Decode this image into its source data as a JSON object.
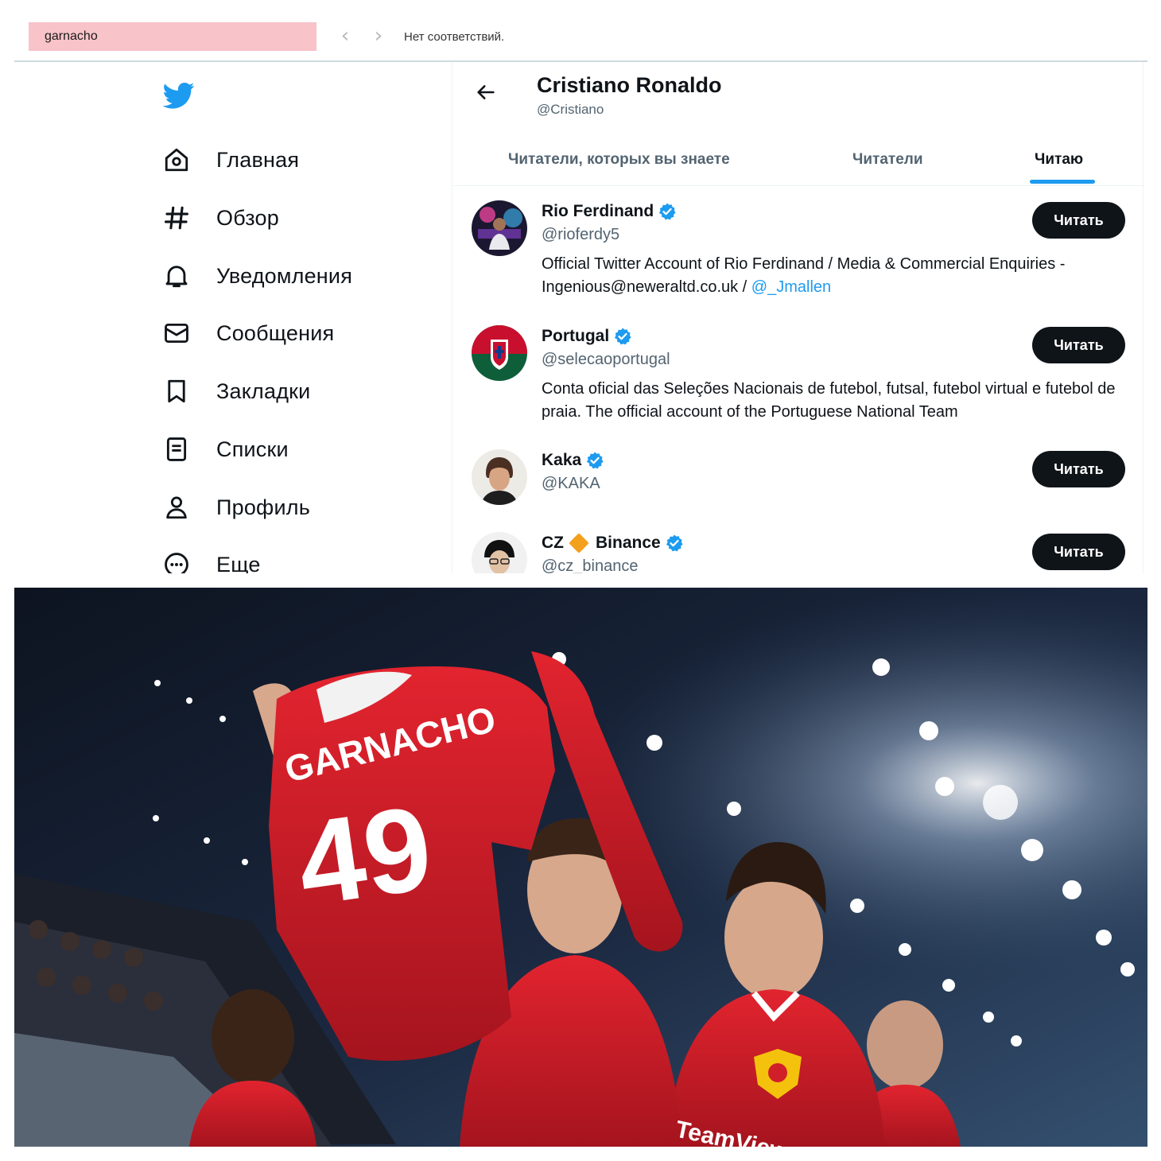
{
  "findbar": {
    "query": "garnacho",
    "status": "Нет соответствий."
  },
  "sidebar": {
    "items": [
      {
        "label": "Главная",
        "icon": "home-icon"
      },
      {
        "label": "Обзор",
        "icon": "hashtag-icon"
      },
      {
        "label": "Уведомления",
        "icon": "bell-icon"
      },
      {
        "label": "Сообщения",
        "icon": "envelope-icon"
      },
      {
        "label": "Закладки",
        "icon": "bookmark-icon"
      },
      {
        "label": "Списки",
        "icon": "list-icon"
      },
      {
        "label": "Профиль",
        "icon": "person-icon"
      },
      {
        "label": "Еще",
        "icon": "more-circle-icon"
      }
    ]
  },
  "header": {
    "name": "Cristiano Ronaldo",
    "handle": "@Cristiano"
  },
  "tabs": [
    {
      "label": "Читатели, которых вы знаете",
      "active": false
    },
    {
      "label": "Читатели",
      "active": false
    },
    {
      "label": "Читаю",
      "active": true
    }
  ],
  "users": [
    {
      "name": "Rio Ferdinand",
      "handle": "@rioferdy5",
      "bio": "Official Twitter Account of Rio Ferdinand / Media & Commercial Enquiries - Ingenious@neweraltd.co.uk / ",
      "bio_mention": "@_Jmallen",
      "follow_label": "Читать"
    },
    {
      "name": "Portugal",
      "handle": "@selecaoportugal",
      "bio": "Conta oficial das Seleções Nacionais de futebol, futsal, futebol virtual e futebol de praia. The official account of the Portuguese National Team",
      "follow_label": "Читать"
    },
    {
      "name": "Kaka",
      "handle": "@KAKA",
      "follow_label": "Читать"
    },
    {
      "name_part1": "CZ",
      "name_part2": "Binance",
      "handle": "@cz_binance",
      "follow_label": "Читать"
    }
  ],
  "photo": {
    "jersey_name": "GARNACHO",
    "jersey_number": "49",
    "shirt_text": "TeamViewer"
  },
  "colors": {
    "accent": "#1d9bf0",
    "find_highlight": "#f8c3c9",
    "button": "#0f1419",
    "united_red": "#d11f2a"
  }
}
